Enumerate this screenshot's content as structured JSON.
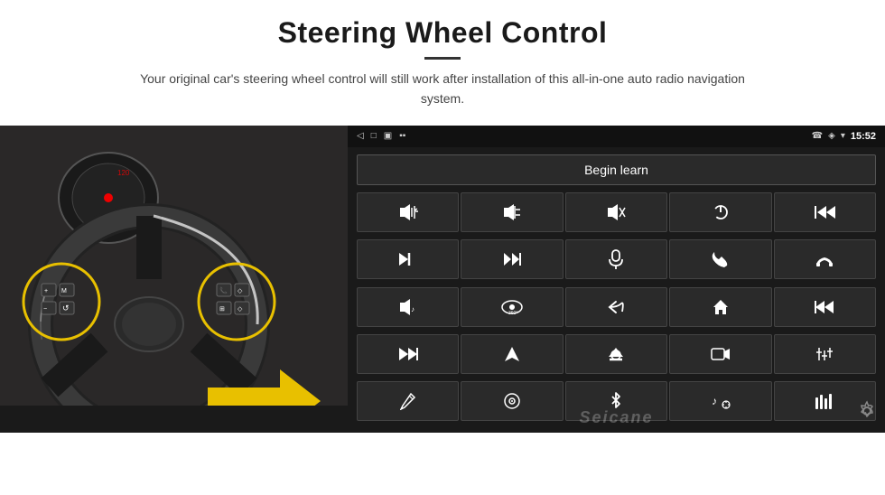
{
  "header": {
    "title": "Steering Wheel Control",
    "subtitle": "Your original car's steering wheel control will still work after installation of this all-in-one auto radio navigation system."
  },
  "status_bar": {
    "back_icon": "◁",
    "home_icon": "□",
    "recent_icon": "▣",
    "signal_icon": "▪▪",
    "phone_icon": "📞",
    "location_icon": "◈",
    "wifi_icon": "▾",
    "time": "15:52"
  },
  "begin_learn": {
    "label": "Begin learn"
  },
  "controls": [
    {
      "icon": "🔊+",
      "name": "vol-up"
    },
    {
      "icon": "🔊−",
      "name": "vol-down"
    },
    {
      "icon": "🔇",
      "name": "mute"
    },
    {
      "icon": "⏻",
      "name": "power"
    },
    {
      "icon": "⏮",
      "name": "prev-track"
    },
    {
      "icon": "⏭",
      "name": "next-track"
    },
    {
      "icon": "⏩",
      "name": "fast-forward"
    },
    {
      "icon": "🎤",
      "name": "mic"
    },
    {
      "icon": "📞",
      "name": "call"
    },
    {
      "icon": "↩",
      "name": "hang-up"
    },
    {
      "icon": "🔈",
      "name": "speaker"
    },
    {
      "icon": "360°",
      "name": "360-view"
    },
    {
      "icon": "↺",
      "name": "back"
    },
    {
      "icon": "⌂",
      "name": "home"
    },
    {
      "icon": "⏮⏮",
      "name": "rewind"
    },
    {
      "icon": "⏭⏭",
      "name": "skip-fwd"
    },
    {
      "icon": "▶",
      "name": "navigate"
    },
    {
      "icon": "⊖",
      "name": "eject"
    },
    {
      "icon": "📷",
      "name": "camera"
    },
    {
      "icon": "⚙",
      "name": "settings-ctrl"
    },
    {
      "icon": "✏",
      "name": "pen"
    },
    {
      "icon": "◉",
      "name": "circle-dot"
    },
    {
      "icon": "✻",
      "name": "bluetooth"
    },
    {
      "icon": "♪⚙",
      "name": "music-settings"
    },
    {
      "icon": "📶",
      "name": "signal-bars"
    }
  ],
  "watermark": "Seicane",
  "gear_icon": "⚙"
}
